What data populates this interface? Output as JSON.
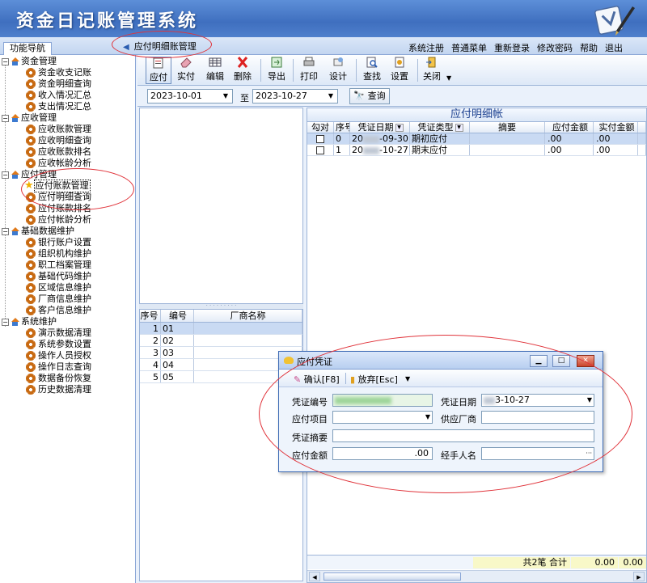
{
  "app": {
    "title": "资金日记账管理系统"
  },
  "header": {
    "nav_tab": "功能导航",
    "module_tab": "应付明细账管理",
    "links": [
      "系统注册",
      "普通菜单",
      "重新登录",
      "修改密码",
      "帮助",
      "退出"
    ]
  },
  "sidebar": {
    "categories": [
      {
        "label": "资金管理",
        "items": [
          "资金收支记账",
          "资金明细查询",
          "收入情况汇总",
          "支出情况汇总"
        ]
      },
      {
        "label": "应收管理",
        "items": [
          "应收账款管理",
          "应收明细查询",
          "应收账款排名",
          "应收帐龄分析"
        ]
      },
      {
        "label": "应付管理",
        "items": [
          "应付账款管理",
          "应付明细查询",
          "应付账款排名",
          "应付帐龄分析"
        ]
      },
      {
        "label": "基础数据维护",
        "items": [
          "银行账户设置",
          "组织机构维护",
          "职工档案管理",
          "基础代码维护",
          "区域信息维护",
          "厂商信息维护",
          "客户信息维护"
        ]
      },
      {
        "label": "系统维护",
        "items": [
          "演示数据清理",
          "系统参数设置",
          "操作人员授权",
          "操作日志查询",
          "数据备份恢复",
          "历史数据清理"
        ]
      }
    ],
    "selected": "应付账款管理"
  },
  "toolbar": {
    "buttons": [
      "应付",
      "实付",
      "编辑",
      "删除",
      "导出",
      "打印",
      "设计",
      "查找",
      "设置",
      "关闭"
    ]
  },
  "filter": {
    "from_date": "2023-10-01",
    "to_label": "至",
    "to_date": "2023-10-27",
    "query_label": "查询"
  },
  "vendor_grid": {
    "headers": [
      "序号",
      "编号",
      "厂商名称"
    ],
    "rows": [
      {
        "no": "1",
        "code": "01",
        "name": ""
      },
      {
        "no": "2",
        "code": "02",
        "name": ""
      },
      {
        "no": "3",
        "code": "03",
        "name": ""
      },
      {
        "no": "4",
        "code": "04",
        "name": ""
      },
      {
        "no": "5",
        "code": "05",
        "name": ""
      }
    ]
  },
  "detail_grid": {
    "title": "应付明细帐",
    "headers": [
      "勾对",
      "序号",
      "凭证日期",
      "凭证类型",
      "摘要",
      "应付金额",
      "实付金额"
    ],
    "rows": [
      {
        "no": "0",
        "date_a": "20",
        "date_b": "-09-30",
        "type": "期初应付",
        "memo": "",
        "amount": ".00",
        "paid": ".00"
      },
      {
        "no": "1",
        "date_a": "20",
        "date_b": "-10-27",
        "type": "期末应付",
        "memo": "",
        "amount": ".00",
        "paid": ".00"
      }
    ],
    "footer": {
      "summary": "共2笔  合计",
      "amount_total": "0.00",
      "paid_total": "0.00"
    }
  },
  "dialog": {
    "title": "应付凭证",
    "confirm_label": "确认[F8]",
    "discard_label": "放弃[Esc]",
    "fields": {
      "voucher_no_label": "凭证编号",
      "voucher_date_label": "凭证日期",
      "voucher_date_value": "3-10-27",
      "item_label": "应付项目",
      "vendor_label": "供应厂商",
      "memo_label": "凭证摘要",
      "amount_label": "应付金额",
      "amount_value": ".00",
      "handler_label": "经手人名",
      "handler_btn": "···"
    }
  }
}
